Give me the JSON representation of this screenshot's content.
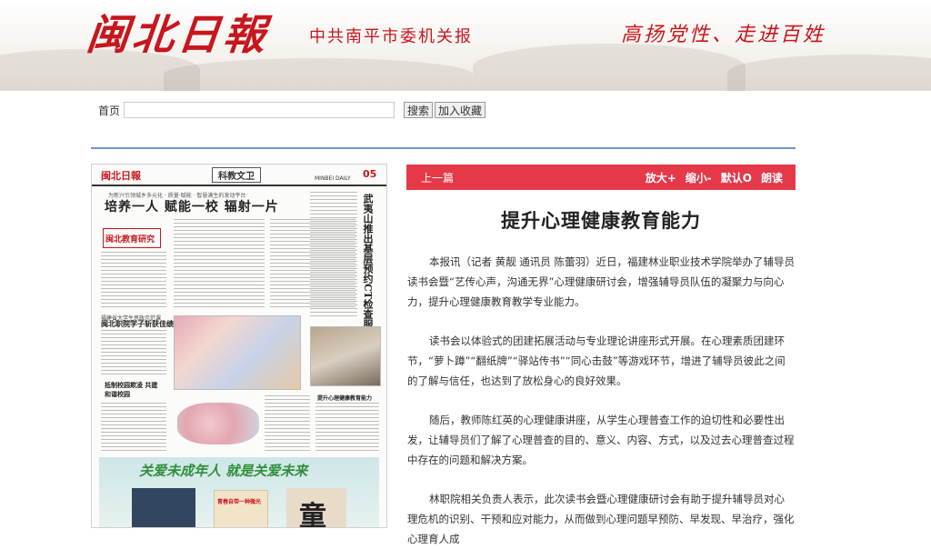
{
  "header": {
    "logo_text": "闽北日報",
    "slogan_left": "中共南平市委机关报",
    "slogan_right": "高扬党性、走进百姓"
  },
  "nav": {
    "home": "首页",
    "search_value": "",
    "search_button": "搜索",
    "favorite_button": "加入收藏"
  },
  "newspaper": {
    "logo": "闽北日報",
    "section": "科教文卫",
    "daily": "MINBEI DAILY",
    "page_number": "05",
    "kicker": "为新兴引领城乡多元化 · 质量·赋能 · 智慧满生的发动平台",
    "headline": "培养一人 赋能一校 辐射一片",
    "vertical_headline": "武夷山推出基层预约CT检查服务",
    "minilogo": "闽北教育研究",
    "subhead2": "福建省大学生思政示范课",
    "headline2": "闽北职院学子斩获佳绩",
    "headline3": "抵制校园欺凌 共建和谐校园",
    "caption": "提升心理健康教育能力",
    "ad_title": "关爱未成年人  就是关爱未来",
    "ad_text": "青春自带一种微光",
    "ad_char": "童"
  },
  "article": {
    "prev_link": "上一篇",
    "tools": [
      "放大+",
      "缩小-",
      "默认O",
      "朗读"
    ],
    "title": "提升心理健康教育能力",
    "paragraphs": [
      "本报讯（记者 黄靓 通讯员 陈蕾羽）近日，福建林业职业技术学院举办了辅导员读书会暨“艺传心声，沟通无界”心理健康研讨会，增强辅导员队伍的凝聚力与向心力，提升心理健康教育教学专业能力。",
      "读书会以体验式的团建拓展活动与专业理论讲座形式开展。在心理素质团建环节，“萝卜蹲”“翻纸牌”“驿站传书”“同心击鼓”等游戏环节，增进了辅导员彼此之间的了解与信任，也达到了放松身心的良好效果。",
      "随后，教师陈红英的心理健康讲座，从学生心理普查工作的迫切性和必要性出发，让辅导员们了解了心理普查的目的、意义、内容、方式，以及过去心理普查过程中存在的问题和解决方案。",
      "林职院相关负责人表示，此次读书会暨心理健康研讨会有助于提升辅导员对心理危机的识别、干预和应对能力，从而做到心理问题早预防、早发现、早治疗，强化心理育人成"
    ]
  },
  "colors": {
    "brand_red": "#c8161d",
    "toolbar_red": "#e5394a",
    "divider_blue": "#6f96c2"
  }
}
